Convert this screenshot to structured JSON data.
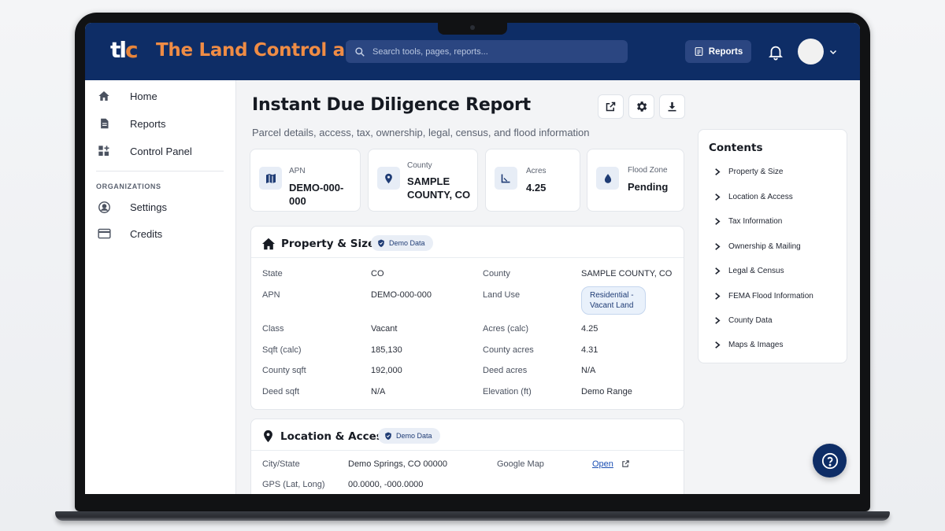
{
  "app": {
    "logo_text": "tlc",
    "title": "The Land Control ai"
  },
  "header": {
    "search_placeholder": "Search tools, pages, reports...",
    "reports_label": "Reports"
  },
  "sidebar": {
    "items": [
      {
        "label": "Home",
        "icon": "home-icon"
      },
      {
        "label": "Reports",
        "icon": "document-icon"
      },
      {
        "label": "Control Panel",
        "icon": "dashboard-add-icon"
      }
    ],
    "section_label": "ORGANIZATIONS",
    "org_items": [
      {
        "label": "Settings",
        "icon": "user-circle-icon"
      },
      {
        "label": "Credits",
        "icon": "credit-card-icon"
      }
    ]
  },
  "page": {
    "title": "Instant Due Diligence Report",
    "subtitle": "Parcel details, access, tax, ownership, legal, census, and flood information"
  },
  "stats": [
    {
      "label": "APN",
      "value": "DEMO-000-000",
      "icon": "map-icon"
    },
    {
      "label": "County",
      "value": "SAMPLE COUNTY, CO",
      "icon": "location-pin-icon"
    },
    {
      "label": "Acres",
      "value": "4.25",
      "icon": "area-ruler-icon"
    },
    {
      "label": "Flood Zone",
      "value": "Pending",
      "icon": "water-drop-icon"
    }
  ],
  "property_section": {
    "title": "Property & Size",
    "badge": "Demo Data",
    "rows_left": [
      {
        "key": "State",
        "value": "CO"
      },
      {
        "key": "APN",
        "value": "DEMO-000-000"
      },
      {
        "key": "Class",
        "value": "Vacant"
      },
      {
        "key": "Sqft (calc)",
        "value": "185,130"
      },
      {
        "key": "County sqft",
        "value": "192,000"
      },
      {
        "key": "Deed sqft",
        "value": "N/A"
      }
    ],
    "rows_right": [
      {
        "key": "County",
        "value": "SAMPLE COUNTY, CO"
      },
      {
        "key": "Land Use",
        "value": "Residential - Vacant Land"
      },
      {
        "key": "Acres (calc)",
        "value": "4.25"
      },
      {
        "key": "County acres",
        "value": "4.31"
      },
      {
        "key": "Deed acres",
        "value": "N/A"
      },
      {
        "key": "Elevation (ft)",
        "value": "Demo Range"
      }
    ]
  },
  "location_section": {
    "title": "Location & Access",
    "badge": "Demo Data",
    "city_label": "City/State",
    "city_value": "Demo Springs, CO 00000",
    "map_label": "Google Map",
    "map_link": "Open",
    "gps_label": "GPS (Lat, Long)",
    "gps_value": "00.0000, -000.0000"
  },
  "contents": {
    "title": "Contents",
    "items": [
      "Property & Size",
      "Location & Access",
      "Tax Information",
      "Ownership & Mailing",
      "Legal & Census",
      "FEMA Flood Information",
      "County Data",
      "Maps & Images"
    ]
  },
  "colors": {
    "header_bg": "#0e2d66",
    "brand_orange": "#ef8c45",
    "accent_blue": "#1f3c75"
  }
}
